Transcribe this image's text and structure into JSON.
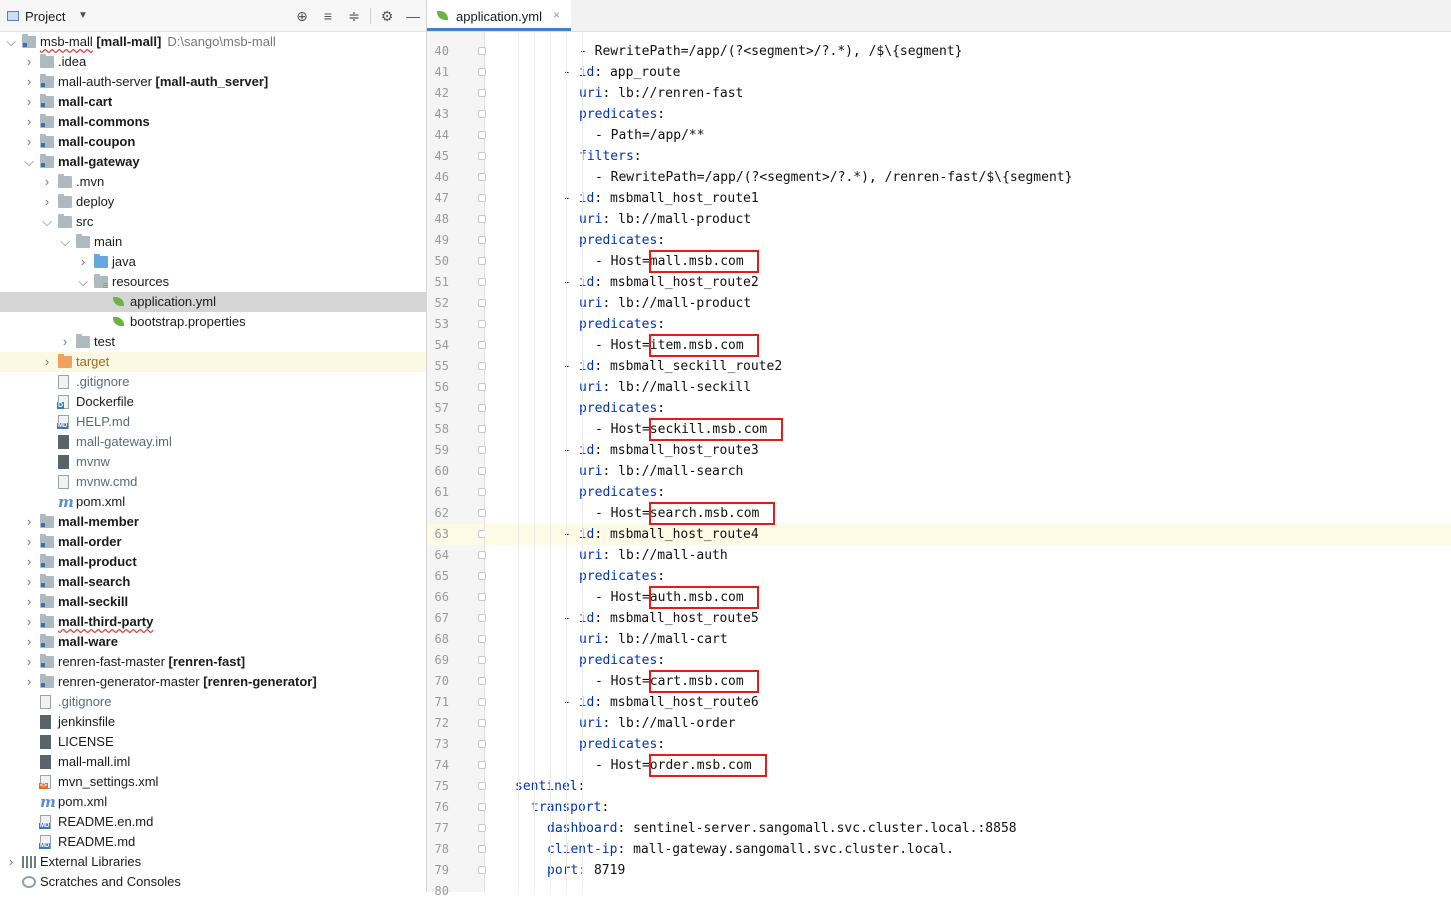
{
  "panel": {
    "title": "Project",
    "toolbar": [
      "locate-icon",
      "expand-all-icon",
      "collapse-all-icon",
      "gear-icon",
      "minimize-icon"
    ]
  },
  "tree": [
    {
      "depth": 0,
      "arrow": "down",
      "icon": "module",
      "name": "msb-mall",
      "extra": "[mall-mall]",
      "path": "D:\\sango\\msb-mall",
      "wavy": true
    },
    {
      "depth": 1,
      "arrow": "right",
      "icon": "folder",
      "name": ".idea"
    },
    {
      "depth": 1,
      "arrow": "right",
      "icon": "module",
      "name": "mall-auth-server",
      "extra": "[mall-auth_server]"
    },
    {
      "depth": 1,
      "arrow": "right",
      "icon": "module",
      "name": "mall-cart",
      "bold": true
    },
    {
      "depth": 1,
      "arrow": "right",
      "icon": "module",
      "name": "mall-commons",
      "bold": true
    },
    {
      "depth": 1,
      "arrow": "right",
      "icon": "module",
      "name": "mall-coupon",
      "bold": true
    },
    {
      "depth": 1,
      "arrow": "down",
      "icon": "module",
      "name": "mall-gateway",
      "bold": true
    },
    {
      "depth": 2,
      "arrow": "right",
      "icon": "folder",
      "name": ".mvn"
    },
    {
      "depth": 2,
      "arrow": "right",
      "icon": "folder",
      "name": "deploy"
    },
    {
      "depth": 2,
      "arrow": "down",
      "icon": "folder",
      "name": "src"
    },
    {
      "depth": 3,
      "arrow": "down",
      "icon": "folder",
      "name": "main"
    },
    {
      "depth": 4,
      "arrow": "right",
      "icon": "folder-blue",
      "name": "java"
    },
    {
      "depth": 4,
      "arrow": "down",
      "icon": "folder-res",
      "name": "resources"
    },
    {
      "depth": 5,
      "arrow": "",
      "icon": "spring",
      "name": "application.yml",
      "selected": true
    },
    {
      "depth": 5,
      "arrow": "",
      "icon": "spring",
      "name": "bootstrap.properties"
    },
    {
      "depth": 3,
      "arrow": "right",
      "icon": "folder",
      "name": "test"
    },
    {
      "depth": 2,
      "arrow": "right",
      "icon": "folder-orange",
      "name": "target",
      "color": "orange",
      "highlight": true
    },
    {
      "depth": 2,
      "arrow": "",
      "icon": "file",
      "name": ".gitignore",
      "color": "muted"
    },
    {
      "depth": 2,
      "arrow": "",
      "icon": "docker",
      "name": "Dockerfile"
    },
    {
      "depth": 2,
      "arrow": "",
      "icon": "md",
      "name": "HELP.md",
      "color": "muted"
    },
    {
      "depth": 2,
      "arrow": "",
      "icon": "file-dark",
      "name": "mall-gateway.iml",
      "color": "muted"
    },
    {
      "depth": 2,
      "arrow": "",
      "icon": "file-dark",
      "name": "mvnw",
      "color": "muted"
    },
    {
      "depth": 2,
      "arrow": "",
      "icon": "file",
      "name": "mvnw.cmd",
      "color": "muted"
    },
    {
      "depth": 2,
      "arrow": "",
      "icon": "maven",
      "name": "pom.xml"
    },
    {
      "depth": 1,
      "arrow": "right",
      "icon": "module",
      "name": "mall-member",
      "bold": true
    },
    {
      "depth": 1,
      "arrow": "right",
      "icon": "module",
      "name": "mall-order",
      "bold": true
    },
    {
      "depth": 1,
      "arrow": "right",
      "icon": "module",
      "name": "mall-product",
      "bold": true
    },
    {
      "depth": 1,
      "arrow": "right",
      "icon": "module",
      "name": "mall-search",
      "bold": true
    },
    {
      "depth": 1,
      "arrow": "right",
      "icon": "module",
      "name": "mall-seckill",
      "bold": true
    },
    {
      "depth": 1,
      "arrow": "right",
      "icon": "module",
      "name": "mall-third-party",
      "bold": true,
      "wavy": true
    },
    {
      "depth": 1,
      "arrow": "right",
      "icon": "module",
      "name": "mall-ware",
      "bold": true
    },
    {
      "depth": 1,
      "arrow": "right",
      "icon": "module",
      "name": "renren-fast-master",
      "extra": "[renren-fast]"
    },
    {
      "depth": 1,
      "arrow": "right",
      "icon": "module",
      "name": "renren-generator-master",
      "extra": "[renren-generator]"
    },
    {
      "depth": 1,
      "arrow": "",
      "icon": "file",
      "name": ".gitignore",
      "color": "muted"
    },
    {
      "depth": 1,
      "arrow": "",
      "icon": "file-dark",
      "name": "jenkinsfile"
    },
    {
      "depth": 1,
      "arrow": "",
      "icon": "file-dark",
      "name": "LICENSE"
    },
    {
      "depth": 1,
      "arrow": "",
      "icon": "file-dark",
      "name": "mall-mall.iml"
    },
    {
      "depth": 1,
      "arrow": "",
      "icon": "xml",
      "name": "mvn_settings.xml"
    },
    {
      "depth": 1,
      "arrow": "",
      "icon": "maven",
      "name": "pom.xml"
    },
    {
      "depth": 1,
      "arrow": "",
      "icon": "md",
      "name": "README.en.md"
    },
    {
      "depth": 1,
      "arrow": "",
      "icon": "md",
      "name": "README.md"
    },
    {
      "depth": 0,
      "arrow": "right",
      "icon": "libs",
      "name": "External Libraries"
    },
    {
      "depth": 0,
      "arrow": "",
      "icon": "scratch",
      "name": "Scratches and Consoles"
    }
  ],
  "editor": {
    "tab_label": "application.yml",
    "tab_close": "×",
    "current_line": 63,
    "lines": [
      {
        "n": 40,
        "indent": 10,
        "parts": [
          [
            "s",
            "- RewritePath=/app/(?<segment>/?.*), /$\\{segment}"
          ]
        ]
      },
      {
        "n": 41,
        "indent": 8,
        "parts": [
          [
            "s",
            "- "
          ],
          [
            "k",
            "id"
          ],
          [
            "s",
            ": app_route"
          ]
        ]
      },
      {
        "n": 42,
        "indent": 10,
        "parts": [
          [
            "k",
            "uri"
          ],
          [
            "s",
            ": lb://renren-fast"
          ]
        ]
      },
      {
        "n": 43,
        "indent": 10,
        "parts": [
          [
            "k",
            "predicates"
          ],
          [
            "s",
            ":"
          ]
        ]
      },
      {
        "n": 44,
        "indent": 12,
        "parts": [
          [
            "s",
            "- Path=/app/**"
          ]
        ]
      },
      {
        "n": 45,
        "indent": 10,
        "parts": [
          [
            "k",
            "filters"
          ],
          [
            "s",
            ":"
          ]
        ]
      },
      {
        "n": 46,
        "indent": 12,
        "parts": [
          [
            "s",
            "- RewritePath=/app/(?<segment>/?.*), /renren-fast/$\\{segment}"
          ]
        ]
      },
      {
        "n": 47,
        "indent": 8,
        "parts": [
          [
            "s",
            "- "
          ],
          [
            "k",
            "id"
          ],
          [
            "s",
            ": msbmall_host_route1"
          ]
        ]
      },
      {
        "n": 48,
        "indent": 10,
        "parts": [
          [
            "k",
            "uri"
          ],
          [
            "s",
            ": lb://mall-product"
          ]
        ]
      },
      {
        "n": 49,
        "indent": 10,
        "parts": [
          [
            "k",
            "predicates"
          ],
          [
            "s",
            ":"
          ]
        ]
      },
      {
        "n": 50,
        "indent": 12,
        "parts": [
          [
            "s",
            "- Host=mall.msb.com"
          ]
        ],
        "box": "mall.msb.com"
      },
      {
        "n": 51,
        "indent": 8,
        "parts": [
          [
            "s",
            "- "
          ],
          [
            "k",
            "id"
          ],
          [
            "s",
            ": msbmall_host_route2"
          ]
        ]
      },
      {
        "n": 52,
        "indent": 10,
        "parts": [
          [
            "k",
            "uri"
          ],
          [
            "s",
            ": lb://mall-product"
          ]
        ]
      },
      {
        "n": 53,
        "indent": 10,
        "parts": [
          [
            "k",
            "predicates"
          ],
          [
            "s",
            ":"
          ]
        ]
      },
      {
        "n": 54,
        "indent": 12,
        "parts": [
          [
            "s",
            "- Host=item.msb.com"
          ]
        ],
        "box": "item.msb.com"
      },
      {
        "n": 55,
        "indent": 8,
        "parts": [
          [
            "s",
            "- "
          ],
          [
            "k",
            "id"
          ],
          [
            "s",
            ": msbmall_seckill_route2"
          ]
        ]
      },
      {
        "n": 56,
        "indent": 10,
        "parts": [
          [
            "k",
            "uri"
          ],
          [
            "s",
            ": lb://mall-seckill"
          ]
        ]
      },
      {
        "n": 57,
        "indent": 10,
        "parts": [
          [
            "k",
            "predicates"
          ],
          [
            "s",
            ":"
          ]
        ]
      },
      {
        "n": 58,
        "indent": 12,
        "parts": [
          [
            "s",
            "- Host=seckill.msb.com"
          ]
        ],
        "box": "seckill.msb.com"
      },
      {
        "n": 59,
        "indent": 8,
        "parts": [
          [
            "s",
            "- "
          ],
          [
            "k",
            "id"
          ],
          [
            "s",
            ": msbmall_host_route3"
          ]
        ]
      },
      {
        "n": 60,
        "indent": 10,
        "parts": [
          [
            "k",
            "uri"
          ],
          [
            "s",
            ": lb://mall-search"
          ]
        ]
      },
      {
        "n": 61,
        "indent": 10,
        "parts": [
          [
            "k",
            "predicates"
          ],
          [
            "s",
            ":"
          ]
        ]
      },
      {
        "n": 62,
        "indent": 12,
        "parts": [
          [
            "s",
            "- Host=search.msb.com"
          ]
        ],
        "box": "search.msb.com"
      },
      {
        "n": 63,
        "indent": 8,
        "parts": [
          [
            "s",
            "- "
          ],
          [
            "k",
            "id"
          ],
          [
            "s",
            ": msbmall_host_route4"
          ]
        ]
      },
      {
        "n": 64,
        "indent": 10,
        "parts": [
          [
            "k",
            "uri"
          ],
          [
            "s",
            ": lb://mall-auth"
          ]
        ]
      },
      {
        "n": 65,
        "indent": 10,
        "parts": [
          [
            "k",
            "predicates"
          ],
          [
            "s",
            ":"
          ]
        ]
      },
      {
        "n": 66,
        "indent": 12,
        "parts": [
          [
            "s",
            "- Host=auth.msb.com"
          ]
        ],
        "box": "auth.msb.com"
      },
      {
        "n": 67,
        "indent": 8,
        "parts": [
          [
            "s",
            "- "
          ],
          [
            "k",
            "id"
          ],
          [
            "s",
            ": msbmall_host_route5"
          ]
        ]
      },
      {
        "n": 68,
        "indent": 10,
        "parts": [
          [
            "k",
            "uri"
          ],
          [
            "s",
            ": lb://mall-cart"
          ]
        ]
      },
      {
        "n": 69,
        "indent": 10,
        "parts": [
          [
            "k",
            "predicates"
          ],
          [
            "s",
            ":"
          ]
        ]
      },
      {
        "n": 70,
        "indent": 12,
        "parts": [
          [
            "s",
            "- Host=cart.msb.com"
          ]
        ],
        "box": "cart.msb.com"
      },
      {
        "n": 71,
        "indent": 8,
        "parts": [
          [
            "s",
            "- "
          ],
          [
            "k",
            "id"
          ],
          [
            "s",
            ": msbmall_host_route6"
          ]
        ]
      },
      {
        "n": 72,
        "indent": 10,
        "parts": [
          [
            "k",
            "uri"
          ],
          [
            "s",
            ": lb://mall-order"
          ]
        ]
      },
      {
        "n": 73,
        "indent": 10,
        "parts": [
          [
            "k",
            "predicates"
          ],
          [
            "s",
            ":"
          ]
        ]
      },
      {
        "n": 74,
        "indent": 12,
        "parts": [
          [
            "s",
            "- Host=order.msb.com"
          ]
        ],
        "box": "order.msb.com"
      },
      {
        "n": 75,
        "indent": 2,
        "parts": [
          [
            "k",
            "sentinel"
          ],
          [
            "s",
            ":"
          ]
        ]
      },
      {
        "n": 76,
        "indent": 4,
        "parts": [
          [
            "k",
            "transport"
          ],
          [
            "s",
            ":"
          ]
        ]
      },
      {
        "n": 77,
        "indent": 6,
        "parts": [
          [
            "k",
            "dashboard"
          ],
          [
            "s",
            ": sentinel-server.sangomall.svc.cluster.local.:8858"
          ]
        ]
      },
      {
        "n": 78,
        "indent": 6,
        "parts": [
          [
            "k",
            "client-ip"
          ],
          [
            "s",
            ": mall-gateway.sangomall.svc.cluster.local."
          ]
        ]
      },
      {
        "n": 79,
        "indent": 6,
        "parts": [
          [
            "k",
            "port"
          ],
          [
            "s",
            ": 8719"
          ]
        ]
      },
      {
        "n": 80,
        "indent": 0,
        "parts": []
      }
    ]
  }
}
